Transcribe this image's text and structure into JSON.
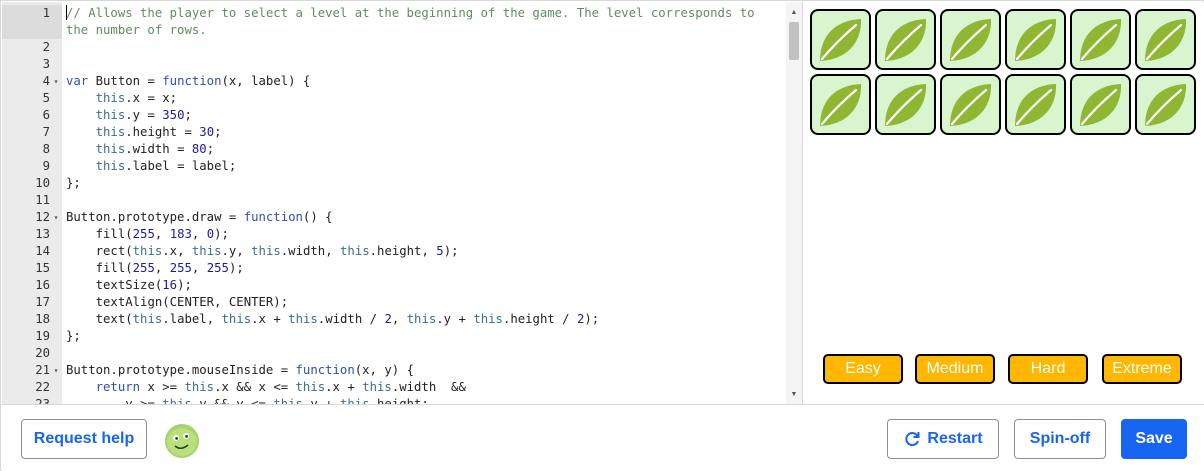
{
  "editor": {
    "lines": [
      {
        "n": "1",
        "fold": "",
        "segments": [
          {
            "c": "cursor",
            "t": ""
          },
          {
            "c": "c-comment",
            "t": "// Allows the player to select a level at the beginning of the game. The level corresponds to the number of rows."
          }
        ]
      },
      {
        "n": "2",
        "fold": "",
        "segments": []
      },
      {
        "n": "3",
        "fold": "",
        "segments": []
      },
      {
        "n": "4",
        "fold": "▾",
        "segments": [
          {
            "c": "c-kw",
            "t": "var"
          },
          {
            "c": "",
            "t": " Button = "
          },
          {
            "c": "c-kw",
            "t": "function"
          },
          {
            "c": "",
            "t": "(x, label) {"
          }
        ]
      },
      {
        "n": "5",
        "fold": "",
        "segments": [
          {
            "c": "",
            "t": "    "
          },
          {
            "c": "c-this",
            "t": "this"
          },
          {
            "c": "",
            "t": ".x = x;"
          }
        ]
      },
      {
        "n": "6",
        "fold": "",
        "segments": [
          {
            "c": "",
            "t": "    "
          },
          {
            "c": "c-this",
            "t": "this"
          },
          {
            "c": "",
            "t": ".y = "
          },
          {
            "c": "c-num",
            "t": "350"
          },
          {
            "c": "",
            "t": ";"
          }
        ]
      },
      {
        "n": "7",
        "fold": "",
        "segments": [
          {
            "c": "",
            "t": "    "
          },
          {
            "c": "c-this",
            "t": "this"
          },
          {
            "c": "",
            "t": ".height = "
          },
          {
            "c": "c-num",
            "t": "30"
          },
          {
            "c": "",
            "t": ";"
          }
        ]
      },
      {
        "n": "8",
        "fold": "",
        "segments": [
          {
            "c": "",
            "t": "    "
          },
          {
            "c": "c-this",
            "t": "this"
          },
          {
            "c": "",
            "t": ".width = "
          },
          {
            "c": "c-num",
            "t": "80"
          },
          {
            "c": "",
            "t": ";"
          }
        ]
      },
      {
        "n": "9",
        "fold": "",
        "segments": [
          {
            "c": "",
            "t": "    "
          },
          {
            "c": "c-this",
            "t": "this"
          },
          {
            "c": "",
            "t": ".label = label;"
          }
        ]
      },
      {
        "n": "10",
        "fold": "",
        "segments": [
          {
            "c": "",
            "t": "};"
          }
        ]
      },
      {
        "n": "11",
        "fold": "",
        "segments": []
      },
      {
        "n": "12",
        "fold": "▾",
        "segments": [
          {
            "c": "",
            "t": "Button.prototype.draw = "
          },
          {
            "c": "c-kw",
            "t": "function"
          },
          {
            "c": "",
            "t": "() {"
          }
        ]
      },
      {
        "n": "13",
        "fold": "",
        "segments": [
          {
            "c": "",
            "t": "    fill("
          },
          {
            "c": "c-num",
            "t": "255"
          },
          {
            "c": "",
            "t": ", "
          },
          {
            "c": "c-num",
            "t": "183"
          },
          {
            "c": "",
            "t": ", "
          },
          {
            "c": "c-num",
            "t": "0"
          },
          {
            "c": "",
            "t": ");"
          }
        ]
      },
      {
        "n": "14",
        "fold": "",
        "segments": [
          {
            "c": "",
            "t": "    rect("
          },
          {
            "c": "c-this",
            "t": "this"
          },
          {
            "c": "",
            "t": ".x, "
          },
          {
            "c": "c-this",
            "t": "this"
          },
          {
            "c": "",
            "t": ".y, "
          },
          {
            "c": "c-this",
            "t": "this"
          },
          {
            "c": "",
            "t": ".width, "
          },
          {
            "c": "c-this",
            "t": "this"
          },
          {
            "c": "",
            "t": ".height, "
          },
          {
            "c": "c-num",
            "t": "5"
          },
          {
            "c": "",
            "t": ");"
          }
        ]
      },
      {
        "n": "15",
        "fold": "",
        "segments": [
          {
            "c": "",
            "t": "    fill("
          },
          {
            "c": "c-num",
            "t": "255"
          },
          {
            "c": "",
            "t": ", "
          },
          {
            "c": "c-num",
            "t": "255"
          },
          {
            "c": "",
            "t": ", "
          },
          {
            "c": "c-num",
            "t": "255"
          },
          {
            "c": "",
            "t": ");"
          }
        ]
      },
      {
        "n": "16",
        "fold": "",
        "segments": [
          {
            "c": "",
            "t": "    textSize("
          },
          {
            "c": "c-num",
            "t": "16"
          },
          {
            "c": "",
            "t": ");"
          }
        ]
      },
      {
        "n": "17",
        "fold": "",
        "segments": [
          {
            "c": "",
            "t": "    textAlign(CENTER, CENTER);"
          }
        ]
      },
      {
        "n": "18",
        "fold": "",
        "segments": [
          {
            "c": "",
            "t": "    text("
          },
          {
            "c": "c-this",
            "t": "this"
          },
          {
            "c": "",
            "t": ".label, "
          },
          {
            "c": "c-this",
            "t": "this"
          },
          {
            "c": "",
            "t": ".x + "
          },
          {
            "c": "c-this",
            "t": "this"
          },
          {
            "c": "",
            "t": ".width / "
          },
          {
            "c": "c-num",
            "t": "2"
          },
          {
            "c": "",
            "t": ", "
          },
          {
            "c": "c-this",
            "t": "this"
          },
          {
            "c": "",
            "t": ".y + "
          },
          {
            "c": "c-this",
            "t": "this"
          },
          {
            "c": "",
            "t": ".height / "
          },
          {
            "c": "c-num",
            "t": "2"
          },
          {
            "c": "",
            "t": ");"
          }
        ]
      },
      {
        "n": "19",
        "fold": "",
        "segments": [
          {
            "c": "",
            "t": "};"
          }
        ]
      },
      {
        "n": "20",
        "fold": "",
        "segments": []
      },
      {
        "n": "21",
        "fold": "▾",
        "segments": [
          {
            "c": "",
            "t": "Button.prototype.mouseInside = "
          },
          {
            "c": "c-kw",
            "t": "function"
          },
          {
            "c": "",
            "t": "(x, y) {"
          }
        ]
      },
      {
        "n": "22",
        "fold": "",
        "segments": [
          {
            "c": "",
            "t": "    "
          },
          {
            "c": "c-kw",
            "t": "return"
          },
          {
            "c": "",
            "t": " x >= "
          },
          {
            "c": "c-this",
            "t": "this"
          },
          {
            "c": "",
            "t": ".x && x <= "
          },
          {
            "c": "c-this",
            "t": "this"
          },
          {
            "c": "",
            "t": ".x + "
          },
          {
            "c": "c-this",
            "t": "this"
          },
          {
            "c": "",
            "t": ".width  &&"
          }
        ]
      },
      {
        "n": "23",
        "fold": "",
        "segments": [
          {
            "c": "",
            "t": "        y >= "
          },
          {
            "c": "c-this",
            "t": "this"
          },
          {
            "c": "",
            "t": ".y && y <= "
          },
          {
            "c": "c-this",
            "t": "this"
          },
          {
            "c": "",
            "t": ".y + "
          },
          {
            "c": "c-this",
            "t": "this"
          },
          {
            "c": "",
            "t": ".height;"
          }
        ]
      }
    ]
  },
  "canvas": {
    "tile_rows": 2,
    "tile_cols": 6,
    "tile_icon": "leaf-icon",
    "level_buttons": [
      {
        "label": "Easy",
        "name": "easy-button"
      },
      {
        "label": "Medium",
        "name": "medium-button"
      },
      {
        "label": "Hard",
        "name": "hard-button"
      },
      {
        "label": "Extreme",
        "name": "extreme-button"
      }
    ],
    "colors": {
      "tile_bg": "#d9f5cf",
      "leaf": "#8fb733",
      "button": "#ffb700"
    }
  },
  "toolbar": {
    "help_label": "Request help",
    "restart_label": "Restart",
    "spinoff_label": "Spin-off",
    "save_label": "Save",
    "accent": "#1865f2"
  }
}
